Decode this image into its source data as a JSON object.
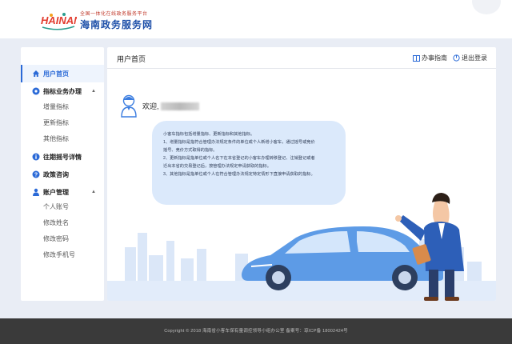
{
  "header": {
    "logo_brand": "HAINAN",
    "logo_tagline": "全国一体化在线政务服务平台",
    "logo_title": "海南政务服务网"
  },
  "sidebar": {
    "items": [
      {
        "label": "用户首页",
        "icon": "home-icon",
        "active": true
      },
      {
        "label": "指标业务办理",
        "icon": "gear-icon",
        "expanded": true,
        "children": [
          "增量指标",
          "更新指标",
          "其他指标"
        ]
      },
      {
        "label": "往期摇号详情",
        "icon": "info-icon"
      },
      {
        "label": "政策咨询",
        "icon": "question-icon"
      },
      {
        "label": "账户管理",
        "icon": "user-icon",
        "expanded": true,
        "children": [
          "个人账号",
          "修改姓名",
          "修改密码",
          "修改手机号"
        ]
      }
    ]
  },
  "content": {
    "title": "用户首页",
    "guide_link": "办事指南",
    "logout_link": "退出登录",
    "welcome": "欢迎,",
    "notice_lines": [
      "小客车指标包括增量指标、更新指标和其他指标。",
      "1、增量指标是指符合管理办法规定条件的单位或个人新增小客车，通过摇号或竞价",
      "摇号、竞价方式取得的指标。",
      "2、更新指标是指单位或个人名下在本省登记的小客车办理转移登记、注销登记或者",
      "迁出本省的交易登记后，按管理办法规定申请获取的指标。",
      "3、其他指标是指单位或个人在符合管理办法规定特定情形下直接申请获取的指标。"
    ]
  },
  "footer": {
    "text": "Copyright © 2018  海南省小客车保有量调控领导小组办公室   备案号：琼ICP备 18002424号"
  },
  "colors": {
    "accent": "#2b6ad7",
    "car_body": "#5d9be6",
    "bubble": "#dbe9fb",
    "footer": "#3a3a3a"
  }
}
